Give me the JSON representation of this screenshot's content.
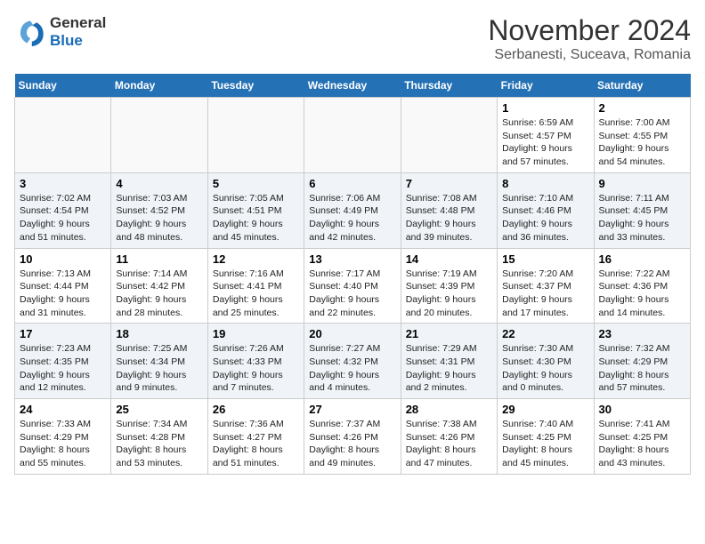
{
  "header": {
    "logo_line1": "General",
    "logo_line2": "Blue",
    "month": "November 2024",
    "location": "Serbanesti, Suceava, Romania"
  },
  "weekdays": [
    "Sunday",
    "Monday",
    "Tuesday",
    "Wednesday",
    "Thursday",
    "Friday",
    "Saturday"
  ],
  "weeks": [
    [
      {
        "day": "",
        "info": ""
      },
      {
        "day": "",
        "info": ""
      },
      {
        "day": "",
        "info": ""
      },
      {
        "day": "",
        "info": ""
      },
      {
        "day": "",
        "info": ""
      },
      {
        "day": "1",
        "info": "Sunrise: 6:59 AM\nSunset: 4:57 PM\nDaylight: 9 hours and 57 minutes."
      },
      {
        "day": "2",
        "info": "Sunrise: 7:00 AM\nSunset: 4:55 PM\nDaylight: 9 hours and 54 minutes."
      }
    ],
    [
      {
        "day": "3",
        "info": "Sunrise: 7:02 AM\nSunset: 4:54 PM\nDaylight: 9 hours and 51 minutes."
      },
      {
        "day": "4",
        "info": "Sunrise: 7:03 AM\nSunset: 4:52 PM\nDaylight: 9 hours and 48 minutes."
      },
      {
        "day": "5",
        "info": "Sunrise: 7:05 AM\nSunset: 4:51 PM\nDaylight: 9 hours and 45 minutes."
      },
      {
        "day": "6",
        "info": "Sunrise: 7:06 AM\nSunset: 4:49 PM\nDaylight: 9 hours and 42 minutes."
      },
      {
        "day": "7",
        "info": "Sunrise: 7:08 AM\nSunset: 4:48 PM\nDaylight: 9 hours and 39 minutes."
      },
      {
        "day": "8",
        "info": "Sunrise: 7:10 AM\nSunset: 4:46 PM\nDaylight: 9 hours and 36 minutes."
      },
      {
        "day": "9",
        "info": "Sunrise: 7:11 AM\nSunset: 4:45 PM\nDaylight: 9 hours and 33 minutes."
      }
    ],
    [
      {
        "day": "10",
        "info": "Sunrise: 7:13 AM\nSunset: 4:44 PM\nDaylight: 9 hours and 31 minutes."
      },
      {
        "day": "11",
        "info": "Sunrise: 7:14 AM\nSunset: 4:42 PM\nDaylight: 9 hours and 28 minutes."
      },
      {
        "day": "12",
        "info": "Sunrise: 7:16 AM\nSunset: 4:41 PM\nDaylight: 9 hours and 25 minutes."
      },
      {
        "day": "13",
        "info": "Sunrise: 7:17 AM\nSunset: 4:40 PM\nDaylight: 9 hours and 22 minutes."
      },
      {
        "day": "14",
        "info": "Sunrise: 7:19 AM\nSunset: 4:39 PM\nDaylight: 9 hours and 20 minutes."
      },
      {
        "day": "15",
        "info": "Sunrise: 7:20 AM\nSunset: 4:37 PM\nDaylight: 9 hours and 17 minutes."
      },
      {
        "day": "16",
        "info": "Sunrise: 7:22 AM\nSunset: 4:36 PM\nDaylight: 9 hours and 14 minutes."
      }
    ],
    [
      {
        "day": "17",
        "info": "Sunrise: 7:23 AM\nSunset: 4:35 PM\nDaylight: 9 hours and 12 minutes."
      },
      {
        "day": "18",
        "info": "Sunrise: 7:25 AM\nSunset: 4:34 PM\nDaylight: 9 hours and 9 minutes."
      },
      {
        "day": "19",
        "info": "Sunrise: 7:26 AM\nSunset: 4:33 PM\nDaylight: 9 hours and 7 minutes."
      },
      {
        "day": "20",
        "info": "Sunrise: 7:27 AM\nSunset: 4:32 PM\nDaylight: 9 hours and 4 minutes."
      },
      {
        "day": "21",
        "info": "Sunrise: 7:29 AM\nSunset: 4:31 PM\nDaylight: 9 hours and 2 minutes."
      },
      {
        "day": "22",
        "info": "Sunrise: 7:30 AM\nSunset: 4:30 PM\nDaylight: 9 hours and 0 minutes."
      },
      {
        "day": "23",
        "info": "Sunrise: 7:32 AM\nSunset: 4:29 PM\nDaylight: 8 hours and 57 minutes."
      }
    ],
    [
      {
        "day": "24",
        "info": "Sunrise: 7:33 AM\nSunset: 4:29 PM\nDaylight: 8 hours and 55 minutes."
      },
      {
        "day": "25",
        "info": "Sunrise: 7:34 AM\nSunset: 4:28 PM\nDaylight: 8 hours and 53 minutes."
      },
      {
        "day": "26",
        "info": "Sunrise: 7:36 AM\nSunset: 4:27 PM\nDaylight: 8 hours and 51 minutes."
      },
      {
        "day": "27",
        "info": "Sunrise: 7:37 AM\nSunset: 4:26 PM\nDaylight: 8 hours and 49 minutes."
      },
      {
        "day": "28",
        "info": "Sunrise: 7:38 AM\nSunset: 4:26 PM\nDaylight: 8 hours and 47 minutes."
      },
      {
        "day": "29",
        "info": "Sunrise: 7:40 AM\nSunset: 4:25 PM\nDaylight: 8 hours and 45 minutes."
      },
      {
        "day": "30",
        "info": "Sunrise: 7:41 AM\nSunset: 4:25 PM\nDaylight: 8 hours and 43 minutes."
      }
    ]
  ]
}
